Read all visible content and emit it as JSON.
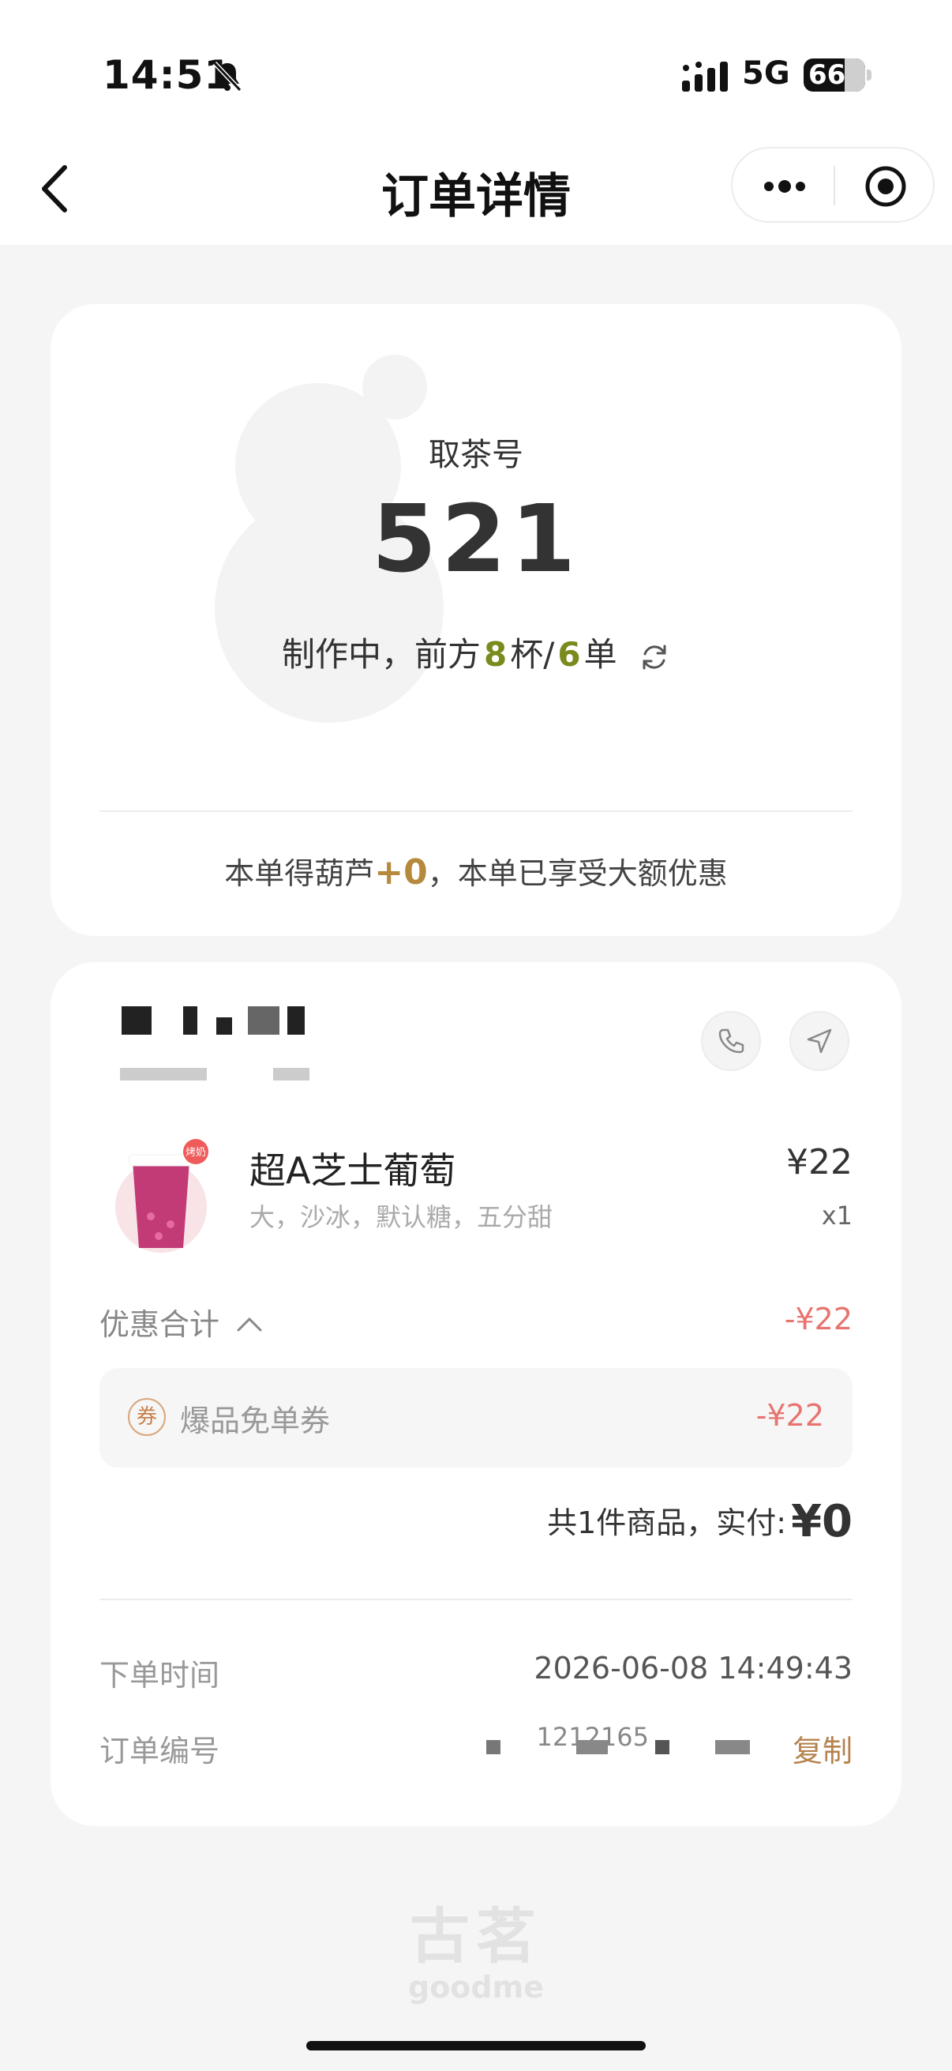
{
  "status_bar": {
    "time": "14:51",
    "network": "5G",
    "battery": "66"
  },
  "nav": {
    "title": "订单详情"
  },
  "pickup": {
    "label": "取茶号",
    "number": "521",
    "status_prefix": "制作中，前方",
    "cups": "8",
    "cups_unit": "杯/",
    "orders": "6",
    "orders_unit": "单",
    "points_prefix": "本单得葫芦",
    "points_value": "+0",
    "points_suffix": "，本单已享受大额优惠"
  },
  "order": {
    "product": {
      "name": "超A芝士葡萄",
      "spec": "大，沙冰，默认糖，五分甜",
      "price": "¥22",
      "qty": "x1",
      "badge": "烤奶"
    },
    "discount_label": "优惠合计",
    "discount_total": "-¥22",
    "coupon": {
      "icon_text": "券",
      "name": "爆品免单券",
      "amount": "-¥22"
    },
    "total_prefix": "共1件商品，实付:",
    "total_amount": "¥0",
    "time_label": "下单时间",
    "time_value": "2026-06-08 14:49:43",
    "order_no_label": "订单编号",
    "order_no_visible": "1212165",
    "copy_label": "复制"
  },
  "brand": {
    "cn": "古茗",
    "en": "goodme"
  },
  "colors": {
    "accent_gold": "#b5834e",
    "discount_red": "#e8736f",
    "queue_green": "#7a8a1c"
  }
}
